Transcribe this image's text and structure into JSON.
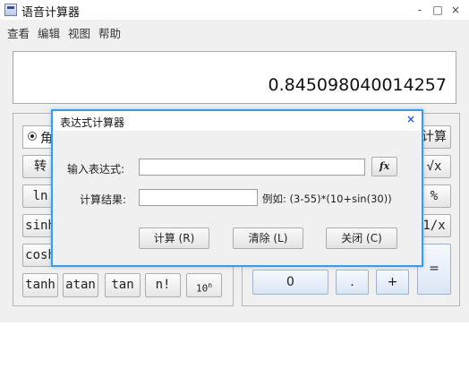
{
  "window": {
    "title": "语音计算器",
    "controls": {
      "minimize": "-",
      "maximize": "□",
      "close": "×"
    }
  },
  "menu": [
    "查看",
    "编辑",
    "视图",
    "帮助"
  ],
  "display": {
    "value": "0.845098040014257"
  },
  "left_panel": {
    "radio_label": "角",
    "row1": [
      "转"
    ],
    "row2": [
      "ln"
    ],
    "row3": [
      "sinh"
    ],
    "row4": [
      "cosh"
    ],
    "bottom": [
      "tanh",
      "atan",
      "tan",
      "n!",
      "10"
    ],
    "pow_exp": "n"
  },
  "right_panel": {
    "partial": [
      "计算",
      "√x",
      "%",
      "1/x"
    ],
    "bottom": [
      "0",
      ".",
      "+"
    ],
    "equals": "="
  },
  "dialog": {
    "title": "表达式计算器",
    "close": "×",
    "expr_label": "输入表达式:",
    "expr_value": "",
    "fx_label": "fx",
    "result_label": "计算结果:",
    "result_value": "",
    "example": "例如: (3-55)*(10+sin(30))",
    "buttons": [
      "计算 (R)",
      "清除 (L)",
      "关闭 (C)"
    ]
  }
}
